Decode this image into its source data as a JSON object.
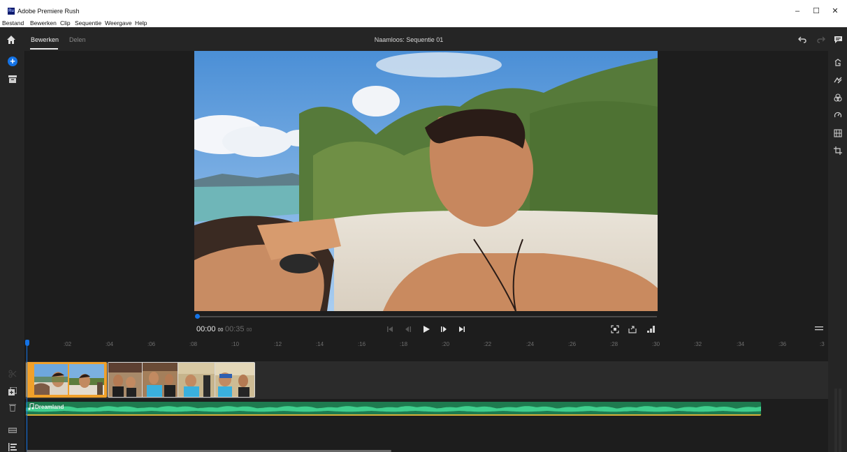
{
  "window": {
    "app_name": "Adobe Premiere Rush",
    "logo_text": "Ru",
    "controls": {
      "minimize": "–",
      "maximize": "☐",
      "close": "✕"
    }
  },
  "menu": [
    "Bestand",
    "Bewerken",
    "Clip",
    "Sequentie",
    "Weergave",
    "Help"
  ],
  "header": {
    "tabs": [
      {
        "label": "Bewerken",
        "active": true
      },
      {
        "label": "Delen",
        "active": false
      }
    ],
    "sequence_title": "Naamloos: Sequentie 01"
  },
  "player": {
    "current_time": "00:00",
    "current_frames": "00",
    "total_time": "00:35",
    "total_frames": "00",
    "progress": 0
  },
  "timeline": {
    "ruler_ticks": [
      ":02",
      ":04",
      ":06",
      ":08",
      ":10",
      ":12",
      ":14",
      ":16",
      ":18",
      ":20",
      ":22",
      ":24",
      ":26",
      ":28",
      ":30",
      ":32",
      ":34",
      ":36",
      ":3"
    ],
    "audio_clip_label": "Dreamland"
  },
  "colors": {
    "accent": "#1473e6",
    "selected_clip": "#f0a02a",
    "audio_clip": "#1e7a4f",
    "waveform": "#3fcf8e"
  },
  "icons": {
    "home": "home-icon",
    "add": "add-media-button",
    "archive": "archive-icon",
    "undo": "undo-icon",
    "redo": "redo-icon",
    "comment": "comment-icon"
  }
}
